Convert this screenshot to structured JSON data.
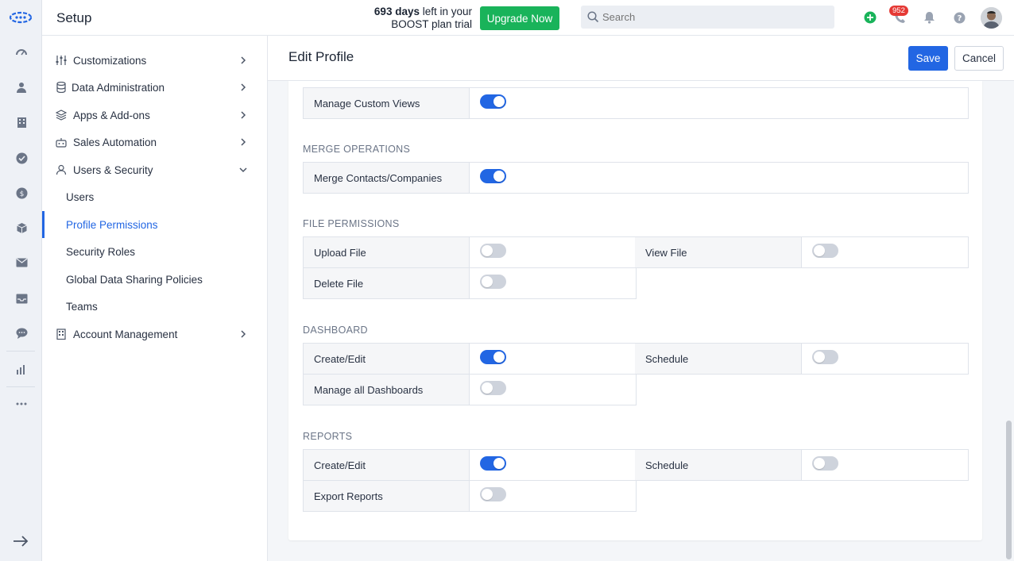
{
  "header": {
    "title": "Setup",
    "trial_days": "693 days",
    "trial_rest_line1": " left in your",
    "trial_line2": "BOOST plan trial",
    "upgrade_label": "Upgrade Now",
    "search_placeholder": "Search",
    "notifications_count": "952"
  },
  "sidebar": {
    "items": [
      {
        "label": "Customizations",
        "icon": "sliders-icon"
      },
      {
        "label": "Data Administration",
        "icon": "database-icon"
      },
      {
        "label": "Apps & Add-ons",
        "icon": "layers-icon"
      },
      {
        "label": "Sales Automation",
        "icon": "robot-icon"
      },
      {
        "label": "Users & Security",
        "icon": "user-icon"
      },
      {
        "label": "Account Management",
        "icon": "building-icon"
      }
    ],
    "sub_items": [
      {
        "label": "Users"
      },
      {
        "label": "Profile Permissions",
        "active": true
      },
      {
        "label": "Security Roles"
      },
      {
        "label": "Global Data Sharing Policies"
      },
      {
        "label": "Teams"
      }
    ]
  },
  "main": {
    "title": "Edit Profile",
    "save_label": "Save",
    "cancel_label": "Cancel",
    "rows_top": [
      {
        "label": "Manage Custom Views",
        "on": true
      }
    ],
    "sections": [
      {
        "title": "MERGE OPERATIONS",
        "rows": [
          {
            "label": "Merge Contacts/Companies",
            "on": true
          }
        ]
      },
      {
        "title": "FILE PERMISSIONS",
        "rows": [
          {
            "label": "Upload File",
            "on": false
          },
          {
            "label": "View File",
            "on": false
          },
          {
            "label": "Delete File",
            "on": false
          }
        ]
      },
      {
        "title": "DASHBOARD",
        "rows": [
          {
            "label": "Create/Edit",
            "on": true
          },
          {
            "label": "Schedule",
            "on": false
          },
          {
            "label": "Manage all Dashboards",
            "on": false
          }
        ]
      },
      {
        "title": "REPORTS",
        "rows": [
          {
            "label": "Create/Edit",
            "on": true
          },
          {
            "label": "Schedule",
            "on": false
          },
          {
            "label": "Export Reports",
            "on": false
          }
        ]
      }
    ]
  },
  "colors": {
    "accent": "#2266e3",
    "upgrade": "#19b35a",
    "badge": "#e53935"
  }
}
